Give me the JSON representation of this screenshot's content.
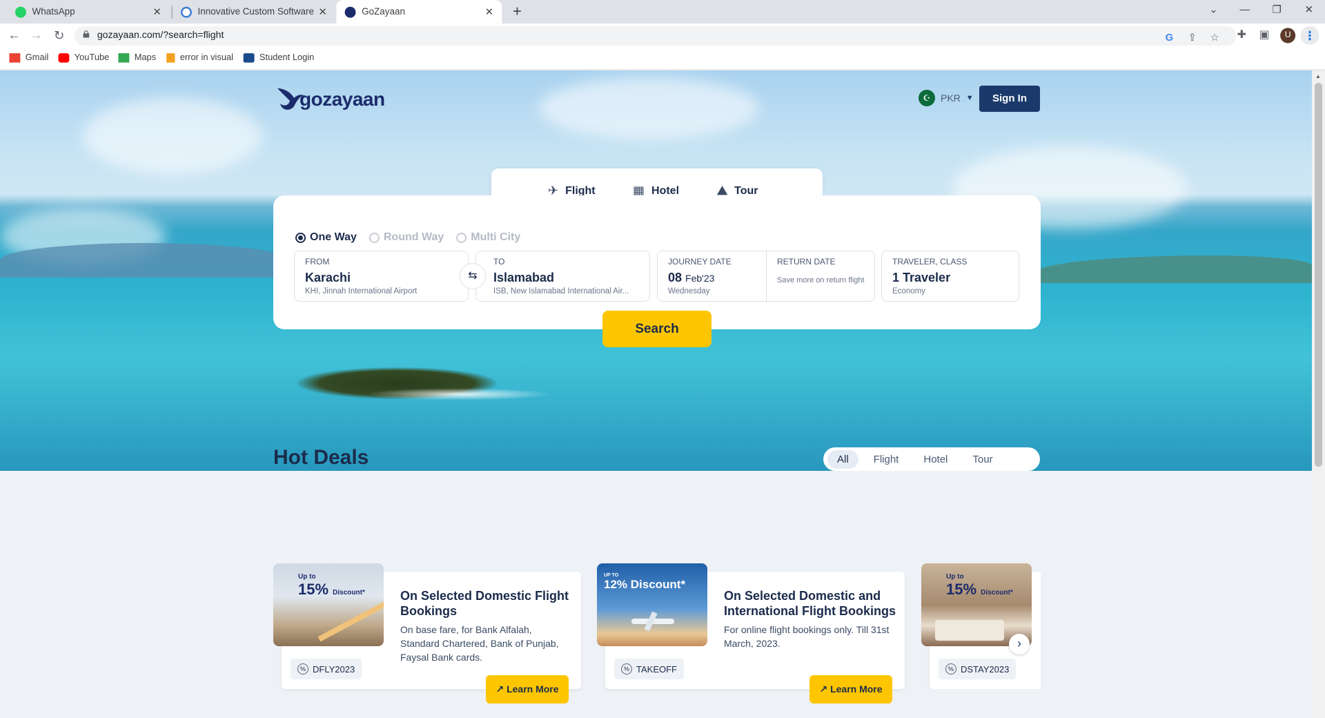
{
  "browser": {
    "tabs": [
      {
        "title": "WhatsApp",
        "favicon_color": "#25d366"
      },
      {
        "title": "Innovative Custom Software Engi",
        "favicon_color": "#3a7bd5"
      },
      {
        "title": "GoZayaan",
        "favicon_color": "#1b2b6b",
        "active": true
      }
    ],
    "url": "gozayaan.com/?search=flight",
    "bookmarks": [
      {
        "label": "Gmail",
        "color": "#ea4335"
      },
      {
        "label": "YouTube",
        "color": "#ff0000"
      },
      {
        "label": "Maps",
        "color": "#34a853"
      },
      {
        "label": "error in visual",
        "color": "#f4a020"
      },
      {
        "label": "Student Login",
        "color": "#1a4b8c"
      }
    ],
    "avatar_letter": "U"
  },
  "header": {
    "logo": "gozayaan",
    "currency": "PKR",
    "sign_in": "Sign In"
  },
  "search": {
    "tabs": [
      {
        "label": "Flight",
        "icon": "airplane-icon",
        "active": true
      },
      {
        "label": "Hotel",
        "icon": "building-icon"
      },
      {
        "label": "Tour",
        "icon": "tour-icon"
      }
    ],
    "trip_types": [
      {
        "label": "One Way",
        "selected": true
      },
      {
        "label": "Round Way"
      },
      {
        "label": "Multi City"
      }
    ],
    "from": {
      "label": "FROM",
      "city": "Karachi",
      "airport": "KHI, Jinnah International Airport"
    },
    "to": {
      "label": "TO",
      "city": "Islamabad",
      "airport": "ISB, New Islamabad International Air..."
    },
    "journey": {
      "label": "JOURNEY DATE",
      "day": "08",
      "month_year": "Feb'23",
      "weekday": "Wednesday"
    },
    "return": {
      "label": "RETURN DATE",
      "hint": "Save more on return flight"
    },
    "traveler": {
      "label": "TRAVELER, CLASS",
      "value": "1 Traveler",
      "class": "Economy"
    },
    "button": "Search"
  },
  "deals": {
    "title": "Hot Deals",
    "filters": [
      "All",
      "Flight",
      "Hotel",
      "Tour"
    ],
    "items": [
      {
        "badge_top": "Up to",
        "badge": "15%",
        "badge_suffix": "Discount*",
        "title": "On Selected Domestic Flight Bookings",
        "desc": "On base fare, for Bank Alfalah, Standard Chartered, Bank of Punjab, Faysal Bank cards.",
        "code": "DFLY2023",
        "cta": "Learn More"
      },
      {
        "badge_top": "UP TO",
        "badge": "12% Discount*",
        "title": "On Selected Domestic and International Flight Bookings",
        "desc": "For online flight bookings only. Till 31st March, 2023.",
        "code": "TAKEOFF",
        "cta": "Learn More"
      },
      {
        "badge_top": "Up to",
        "badge": "15%",
        "badge_suffix": "Discount*",
        "code": "DSTAY2023"
      }
    ]
  },
  "colors": {
    "brand_navy": "#1b3a6b",
    "accent_yellow": "#fdc600"
  }
}
